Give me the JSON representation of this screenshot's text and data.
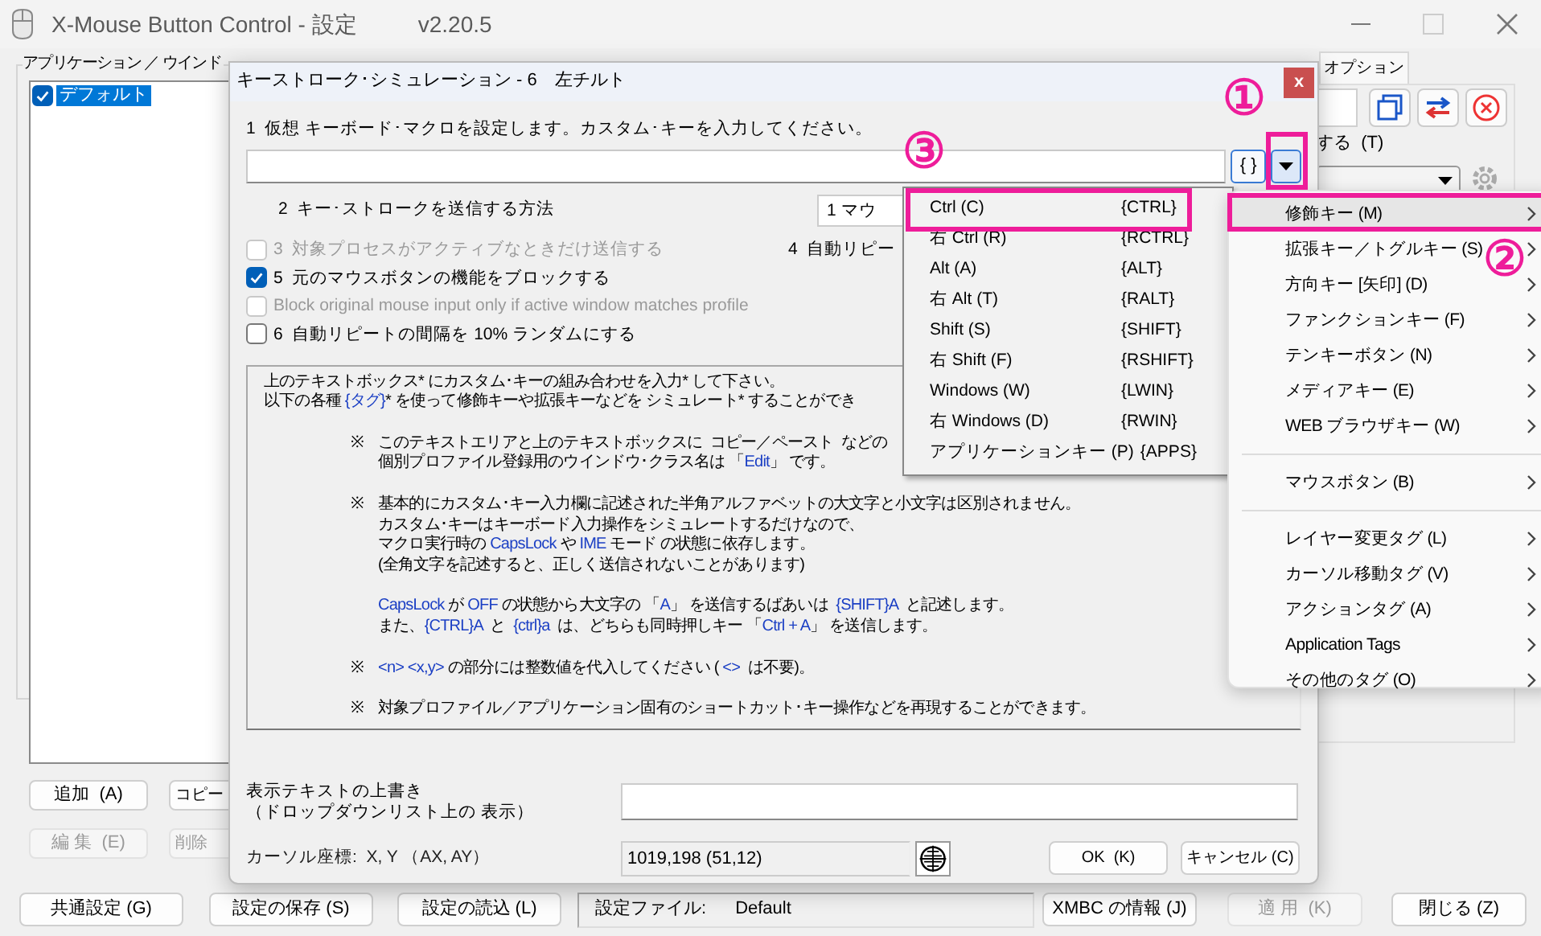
{
  "window": {
    "title": "X-Mouse Button Control - 設定",
    "version": "v2.20.5"
  },
  "profiles": {
    "label": "アプリケーション ／ ウインド",
    "items": [
      {
        "label": "デフォルト",
        "checked": true,
        "selected": true
      }
    ]
  },
  "profile_buttons": [
    {
      "label": "追加  (A)",
      "disabled": false
    },
    {
      "label": "コピー",
      "disabled": false
    },
    {
      "label": "編 集  (E)",
      "disabled": true
    },
    {
      "label": "削除",
      "disabled": true
    }
  ],
  "right_panel": {
    "tab": "オプション",
    "field_label": "する  (T)"
  },
  "footer": {
    "left_buttons": [
      {
        "label": "共通設定 (G)",
        "disabled": false
      },
      {
        "label": "設定の保存 (S)",
        "disabled": false
      },
      {
        "label": "設定の読込 (L)",
        "disabled": false
      }
    ],
    "file_label": "設定ファイル:",
    "file_value": "Default",
    "right_buttons": [
      {
        "label": "XMBC の情報 (J)",
        "disabled": false
      },
      {
        "label": "適 用  (K)",
        "disabled": true
      },
      {
        "label": "閉じる (Z)",
        "disabled": false
      }
    ]
  },
  "dialog": {
    "title": "キーストローク･シミュレーション - 6　左チルト",
    "close": "x",
    "step1": "1  仮想 キーボード･マクロを設定します。カスタム･キーを入力してください。",
    "tag_button": "{ }",
    "step2": "2  キー･ストロークを送信する方法",
    "method": "1 マウ",
    "step4": "4  自動リピー",
    "options": [
      {
        "label": "3  対象プロセスがアクティブなときだけ送信する",
        "checked": false,
        "disabled": true
      },
      {
        "label": "5  元のマウスボタンの機能をブロックする",
        "checked": true,
        "disabled": false
      },
      {
        "label": "Block original mouse input only if active window matches profile",
        "checked": false,
        "disabled": true
      },
      {
        "label": "6  自動リピートの間隔を 10% ランダムにする",
        "checked": false,
        "disabled": false
      }
    ],
    "help": [
      {
        "kind": "intro",
        "lines": [
          [
            "上のテキストボックス* にカスタム･キーの組み合わせを入力* して下さい。"
          ],
          [
            "以下の各種 ",
            {
              "tag": "{タグ}"
            },
            "* を使って修飾キーや拡張キーなどを シミュレート* することができ"
          ]
        ]
      },
      {
        "kind": "note",
        "mark": "※",
        "lines": [
          [
            "このテキストエリアと上のテキストボックスに  コピー／ペースト  などの"
          ],
          [
            "個別プロファイル登録用のウインドウ･クラス名は 「",
            {
              "tag": "Edit"
            },
            "」 です。"
          ]
        ]
      },
      {
        "kind": "note",
        "mark": "※",
        "lines": [
          [
            "基本的にカスタム･キー入力欄に記述された半角アルファベットの大文字と小文字は区別されません。"
          ],
          [
            "カスタム･キーはキーボード入力操作をシミュレートするだけなので、"
          ],
          [
            "マクロ実行時の ",
            {
              "tag": "CapsLock"
            },
            " や ",
            {
              "tag": "IME"
            },
            " モード の状態に依存します。"
          ],
          [
            "(全角文字を記述すると、正しく送信されないことがあります)"
          ]
        ]
      },
      {
        "kind": "continuation",
        "lines": [
          [
            {
              "tag": "CapsLock"
            },
            " が ",
            {
              "tag": "OFF"
            },
            " の状態から大文字の 「",
            {
              "tag": "A"
            },
            "」 を送信するばあいは  ",
            {
              "tag": "{SHIFT}A"
            },
            "  と記述します。"
          ],
          [
            "また、",
            {
              "tag": "{CTRL}A"
            },
            "  と  ",
            {
              "tag": "{ctrl}a"
            },
            "  は、どちらも同時押しキー 「",
            {
              "tag": "Ctrl + A"
            },
            "」 を送信します。"
          ]
        ]
      },
      {
        "kind": "note",
        "mark": "※",
        "lines": [
          [
            {
              "tag": "<n> <x,y>"
            },
            " の部分には整数値を代入してください ( ",
            {
              "tag": "<>"
            },
            "  は不要)。"
          ]
        ]
      },
      {
        "kind": "note",
        "mark": "※",
        "lines": [
          [
            "対象プロファイル／アプリケーション固有のショートカット･キー操作などを再現することができます。"
          ]
        ]
      }
    ],
    "override_label": [
      "表示テキストの上書き",
      "（ドロップダウンリスト上の 表示）"
    ],
    "cursor_label": "カーソル座標:  X, Y （AX, AY）",
    "cursor_value": "1019,198 (51,12)",
    "buttons": [
      "OK  (K)",
      "キャンセル (C)"
    ]
  },
  "key_menu": [
    {
      "label": "Ctrl (C)",
      "tag": "{CTRL}"
    },
    {
      "label": "右 Ctrl (R)",
      "tag": "{RCTRL}"
    },
    {
      "label": "Alt (A)",
      "tag": "{ALT}"
    },
    {
      "label": "右 Alt (T)",
      "tag": "{RALT}"
    },
    {
      "label": "Shift (S)",
      "tag": "{SHIFT}"
    },
    {
      "label": "右 Shift (F)",
      "tag": "{RSHIFT}"
    },
    {
      "label": "Windows (W)",
      "tag": "{LWIN}"
    },
    {
      "label": "右 Windows (D)",
      "tag": "{RWIN}"
    },
    {
      "label": "アプリケーションキー (P)",
      "tag": "{APPS}"
    }
  ],
  "category_menu": [
    {
      "kind": "item",
      "label": "修飾キー (M)",
      "selected": true
    },
    {
      "kind": "item",
      "label": "拡張キー／トグルキー (S)",
      "selected": false
    },
    {
      "kind": "item",
      "label": "方向キー [矢印] (D)",
      "selected": false
    },
    {
      "kind": "item",
      "label": "ファンクションキー (F)",
      "selected": false
    },
    {
      "kind": "item",
      "label": "テンキーボタン (N)",
      "selected": false
    },
    {
      "kind": "item",
      "label": "メディアキー (E)",
      "selected": false
    },
    {
      "kind": "item",
      "label": "WEB ブラウザキー (W)",
      "selected": false
    },
    {
      "kind": "separator"
    },
    {
      "kind": "item",
      "label": "マウスボタン (B)",
      "selected": false
    },
    {
      "kind": "separator"
    },
    {
      "kind": "item",
      "label": "レイヤー変更タグ (L)",
      "selected": false
    },
    {
      "kind": "item",
      "label": "カーソル移動タグ (V)",
      "selected": false
    },
    {
      "kind": "item",
      "label": "アクションタグ (A)",
      "selected": false
    },
    {
      "kind": "item",
      "label": "Application Tags",
      "selected": false
    },
    {
      "kind": "item",
      "label": "その他のタグ (O)",
      "selected": false
    }
  ],
  "annotations": [
    {
      "text": "①"
    },
    {
      "text": "②"
    },
    {
      "text": "③"
    }
  ]
}
